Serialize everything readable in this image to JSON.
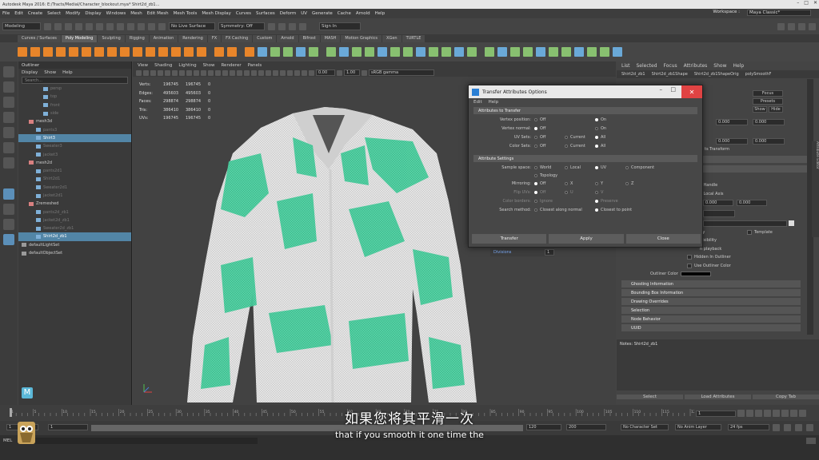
{
  "window": {
    "title": "Autodesk Maya 2016: E:/Tracts/Medial/Character_blockout.mya* Shirt2d_zb1..."
  },
  "menubar": {
    "items": [
      "File",
      "Edit",
      "Create",
      "Select",
      "Modify",
      "Display",
      "Windows",
      "Mesh",
      "Edit Mesh",
      "Mesh Tools",
      "Mesh Display",
      "Curves",
      "Surfaces",
      "Deform",
      "UV",
      "Generate",
      "Cache",
      "Arnold",
      "Help"
    ],
    "workspace_label": "Workspace :",
    "workspace_value": "Maya Classic*"
  },
  "statusline": {
    "mode": "Modeling",
    "live_surface": "No Live Surface",
    "symmetry": "Symmetry: Off",
    "sign_in": "Sign In"
  },
  "shelf": {
    "tabs": [
      "Curves / Surfaces",
      "Poly Modeling",
      "Sculpting",
      "Rigging",
      "Animation",
      "Rendering",
      "FX",
      "FX Caching",
      "Custom",
      "Arnold",
      "Bifrost",
      "MASH",
      "Motion Graphics",
      "XGen",
      "TURTLE"
    ],
    "active_tab": "Poly Modeling"
  },
  "outliner": {
    "title": "Outliner",
    "menu": [
      "Display",
      "Show",
      "Help"
    ],
    "search_placeholder": "Search...",
    "items": [
      {
        "label": "persp",
        "indent": 3,
        "type": "cam",
        "dim": true
      },
      {
        "label": "top",
        "indent": 3,
        "type": "cam",
        "dim": true
      },
      {
        "label": "front",
        "indent": 3,
        "type": "cam",
        "dim": true
      },
      {
        "label": "side",
        "indent": 3,
        "type": "cam",
        "dim": true
      },
      {
        "label": "mesh3d",
        "indent": 1,
        "type": "mesh"
      },
      {
        "label": "pants3",
        "indent": 2,
        "type": "obj",
        "dim": true
      },
      {
        "label": "Shirt3",
        "indent": 2,
        "type": "obj",
        "selected": true
      },
      {
        "label": "Sweater3",
        "indent": 2,
        "type": "obj",
        "dim": true
      },
      {
        "label": "jacket3",
        "indent": 2,
        "type": "obj",
        "dim": true
      },
      {
        "label": "mesh2d",
        "indent": 1,
        "type": "mesh"
      },
      {
        "label": "pants2d1",
        "indent": 2,
        "type": "obj",
        "dim": true
      },
      {
        "label": "Shirt2d1",
        "indent": 2,
        "type": "obj",
        "dim": true
      },
      {
        "label": "Sweater2d1",
        "indent": 2,
        "type": "obj",
        "dim": true
      },
      {
        "label": "jacket2d1",
        "indent": 2,
        "type": "obj",
        "dim": true
      },
      {
        "label": "Zremeshed",
        "indent": 1,
        "type": "mesh"
      },
      {
        "label": "pants2d_zb1",
        "indent": 2,
        "type": "obj",
        "dim": true
      },
      {
        "label": "jacket2d_zb1",
        "indent": 2,
        "type": "obj",
        "dim": true
      },
      {
        "label": "Sweater2d_zb1",
        "indent": 2,
        "type": "obj",
        "dim": true
      },
      {
        "label": "Shirt2d_zb1",
        "indent": 2,
        "type": "obj",
        "selected": true
      },
      {
        "label": "defaultLightSet",
        "indent": 0,
        "type": "set"
      },
      {
        "label": "defaultObjectSet",
        "indent": 0,
        "type": "set"
      }
    ]
  },
  "viewport": {
    "menu": [
      "View",
      "Shading",
      "Lighting",
      "Show",
      "Renderer",
      "Panels"
    ],
    "field1": "0.00",
    "field2": "1.00",
    "color_space": "sRGB gamma",
    "hud": [
      {
        "k": "Verts:",
        "a": "196745",
        "b": "196745",
        "c": "0"
      },
      {
        "k": "Edges:",
        "a": "495603",
        "b": "495603",
        "c": "0"
      },
      {
        "k": "Faces:",
        "a": "298874",
        "b": "298874",
        "c": "0"
      },
      {
        "k": "Tris:",
        "a": "386410",
        "b": "386410",
        "c": "0"
      },
      {
        "k": "UVs:",
        "a": "196745",
        "b": "196745",
        "c": "0"
      }
    ]
  },
  "attribute_editor": {
    "menu": [
      "List",
      "Selected",
      "Focus",
      "Attributes",
      "Show",
      "Help"
    ],
    "tabs": [
      "Shirt2d_zb1",
      "Shirt2d_zb1Shape",
      "Shirt2d_zb1ShapeOrig",
      "polySmoothF"
    ],
    "focus_button": "Focus",
    "presets_button": "Presets",
    "show_button": "Show",
    "hide_button": "Hide",
    "values": [
      "0.000",
      "0.000",
      "0.000",
      "0.000",
      "0.000",
      "0.000"
    ],
    "labels": [
      "ts Transform",
      "y Handle",
      "y Local Axis",
      "ity",
      "Template",
      "Visibility",
      "n playback",
      "Hidden In Outliner",
      "Use Outliner Color",
      "Outliner Color",
      "Divisions"
    ],
    "divisions_value": "1",
    "sections": [
      "Ghosting Information",
      "Bounding Box Information",
      "Drawing Overrides",
      "Selection",
      "Node Behavior",
      "UUID"
    ],
    "notes_label": "Notes: Shirt2d_zb1",
    "bottom_buttons": [
      "Select",
      "Load Attributes",
      "Copy Tab"
    ]
  },
  "dialog": {
    "title": "Transfer Attributes Options",
    "menu": [
      "Edit",
      "Help"
    ],
    "section1": "Attributes to Transfer",
    "vertex_position": {
      "label": "Vertex position:",
      "opts": [
        "Off",
        "On"
      ],
      "sel": 1
    },
    "vertex_normal": {
      "label": "Vertex normal:",
      "opts": [
        "Off",
        "On"
      ],
      "sel": 0
    },
    "uv_sets": {
      "label": "UV Sets:",
      "opts": [
        "Off",
        "Current",
        "All"
      ],
      "sel": 2
    },
    "color_sets": {
      "label": "Color Sets:",
      "opts": [
        "Off",
        "Current",
        "All"
      ],
      "sel": 2
    },
    "section2": "Attribute Settings",
    "sample_space": {
      "label": "Sample space:",
      "opts": [
        "World",
        "Local",
        "UV",
        "Component",
        "Topology"
      ],
      "sel": 2
    },
    "mirroring": {
      "label": "Mirroring:",
      "opts": [
        "Off",
        "X",
        "Y",
        "Z"
      ],
      "sel": 0
    },
    "flip_uvs": {
      "label": "Flip UVs:",
      "opts": [
        "Off",
        "U",
        "V"
      ],
      "sel": 0
    },
    "color_borders": {
      "label": "Color borders:",
      "opts": [
        "Ignore",
        "Preserve"
      ],
      "sel": 1
    },
    "search_method": {
      "label": "Search method:",
      "opts": [
        "Closest along normal",
        "Closest to point"
      ],
      "sel": 1
    },
    "buttons": [
      "Transfer",
      "Apply",
      "Close"
    ]
  },
  "timeline": {
    "ticks": [
      "1",
      "5",
      "10",
      "15",
      "20",
      "25",
      "30",
      "35",
      "40",
      "45",
      "50",
      "55",
      "60",
      "65",
      "70",
      "75",
      "80",
      "85",
      "90",
      "95",
      "100",
      "105",
      "110",
      "115",
      "120"
    ],
    "current_frame": "1",
    "range_start": "1",
    "range_start2": "1",
    "range_end": "120",
    "range_end2": "120",
    "anim_end": "200",
    "character_set": "No Character Set",
    "anim_layer": "No Anim Layer",
    "fps": "24 fps"
  },
  "mel_label": "MEL",
  "subtitles": {
    "chinese": "如果您将其平滑一次",
    "english": "that if you smooth it one time the"
  },
  "colors": {
    "accent": "#5285a6",
    "shelf_icon": "#e8852a",
    "wire": "#50d6a6",
    "close": "#e04343"
  }
}
